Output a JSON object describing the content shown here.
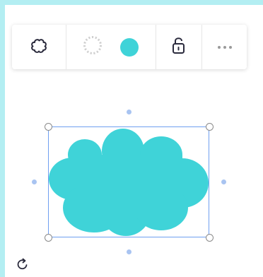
{
  "colors": {
    "background": "#b3eef2",
    "canvas": "#ffffff",
    "shape_fill": "#3fd3d8",
    "selection": "#6f9ff0",
    "icon": "#2a2a3c"
  },
  "toolbar": {
    "shape_icon": "cloud-outline-icon",
    "border_icon": "dotted-circle-icon",
    "fill_swatch": "#3fd3d8",
    "lock_icon": "unlock-icon",
    "more_icon": "more-dots-icon"
  },
  "shape": {
    "type": "cloud",
    "icon": "cloud-shape"
  },
  "rotate_icon": "rotate-icon"
}
